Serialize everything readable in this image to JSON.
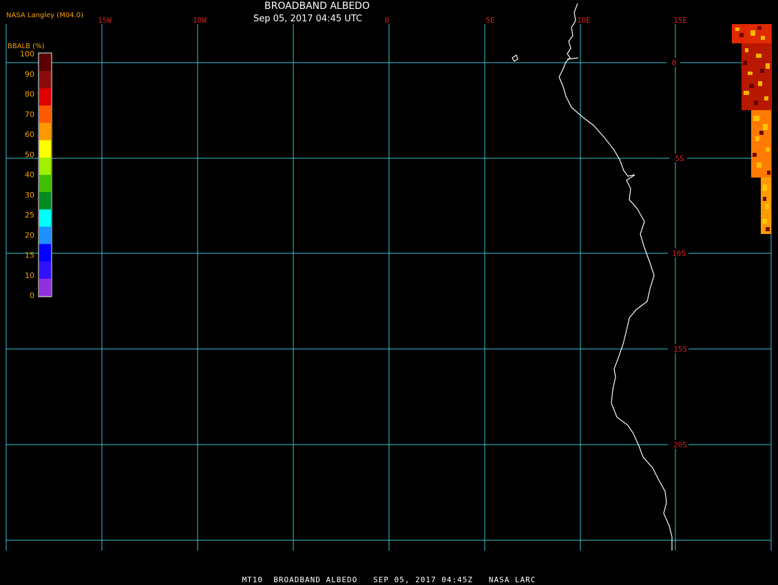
{
  "header": {
    "title": "BROADBAND ALBEDO",
    "subtitle": "Sep 05, 2017 04:45 UTC",
    "credit": "NASA Langley (M04.0)"
  },
  "legend": {
    "title": "BBALB (%)",
    "ticks": [
      "100",
      "90",
      "80",
      "70",
      "60",
      "50",
      "40",
      "30",
      "25",
      "20",
      "15",
      "10",
      "0"
    ],
    "colors": [
      "#5a0000",
      "#8b0a0a",
      "#e00000",
      "#ff5a00",
      "#ff9900",
      "#ffff00",
      "#a0f000",
      "#40c000",
      "#008a20",
      "#00ffff",
      "#1e90ff",
      "#0000ff",
      "#3010ff",
      "#9030e0"
    ]
  },
  "longitude_labels": [
    "15W",
    "10W",
    "0",
    "5E",
    "10E",
    "15E"
  ],
  "latitude_labels": [
    "0",
    "5S",
    "10S",
    "15S",
    "20S"
  ],
  "footer": "MT10  BROADBAND ALBEDO   SEP 05, 2017 04:45Z   NASA LARC",
  "colors": {
    "grid": "#38c8d8",
    "coast": "#ffffff",
    "lon_label": "#d42020",
    "lat_label": "#d42020",
    "legend_text": "#f5a300"
  }
}
